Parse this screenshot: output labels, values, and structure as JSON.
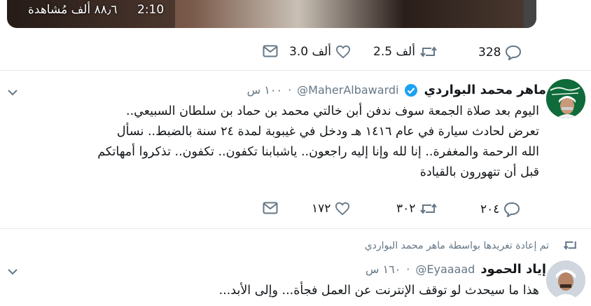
{
  "video": {
    "time": "2:10",
    "views": "٨٨٫٦ ألف مُشاهدة"
  },
  "tweet1_actions": {
    "replies": "328",
    "retweets": "2.5 ألف",
    "likes": "3.0 ألف"
  },
  "tweet2": {
    "name": "ماهر محمد البواردي",
    "handle": "@MaherAlbawardi",
    "time": "١٠٠ س",
    "lines": [
      "اليوم بعد صلاة الجمعة سوف ندفن أبن خالتي محمد بن حماد بن سلطان السبيعي..",
      "تعرض لحادث سيارة في عام ١٤١٦ هـ  ودخل في غيبوبة لمدة ٢٤ سنة بالضبط.. نسأل",
      "الله الرحمة والمغفرة.. إنا لله وإنا إليه راجعون.. ياشبابنا تكفون.. تكفون.. تذكروا أمهاتكم",
      "قبل أن تتهورون بالقيادة"
    ],
    "replies": "٢٠٤",
    "retweets": "٣٠٢",
    "likes": "١٧٢"
  },
  "tweet3": {
    "retweeted_by": "تم إعادة تغريدها بواسطة ماهر محمد البواردي",
    "name": "إياد الحمود",
    "handle": "@Eyaaaad",
    "time": "١٦٠ س",
    "text": "هذا ما سيحدث لو توقف الإنترنت عن العمل فجأة... وإلى الأبد..."
  },
  "colors": {
    "verified": "#1da1f2",
    "icon": "#657786",
    "divider": "#e6ecf0"
  }
}
